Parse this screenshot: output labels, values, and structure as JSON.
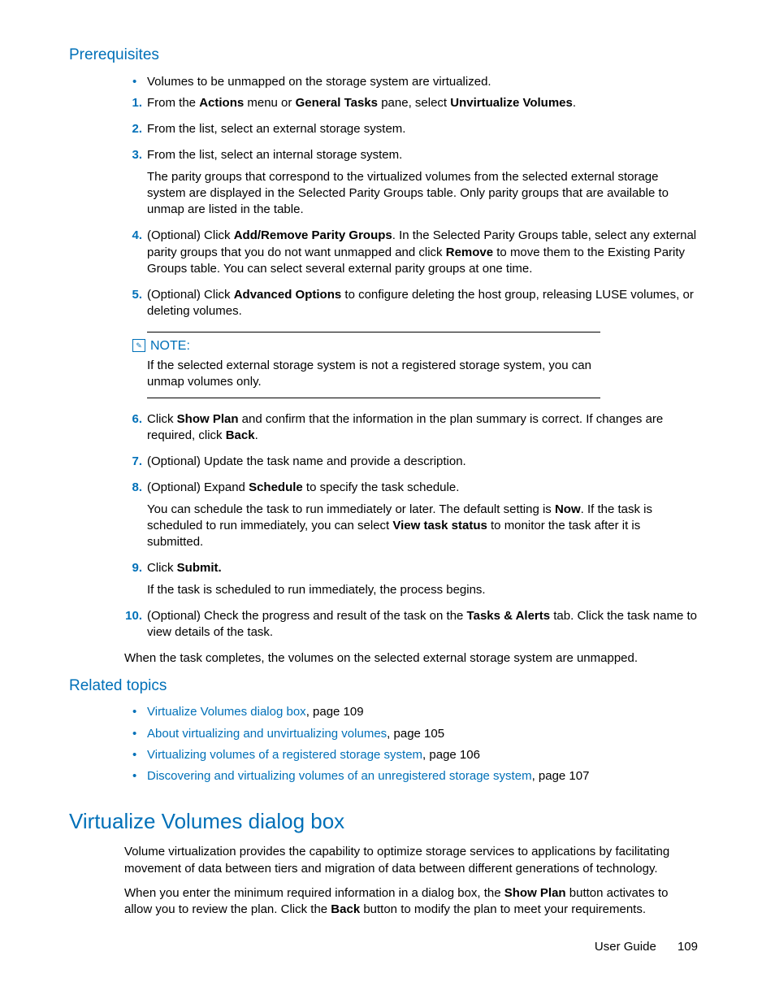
{
  "sections": {
    "prereq_heading": "Prerequisites",
    "related_heading": "Related topics",
    "dialog_heading": "Virtualize Volumes dialog box"
  },
  "prereq_bullet": "Volumes to be unmapped on the storage system are virtualized.",
  "steps": {
    "s1": {
      "num": "1.",
      "pre": "From the ",
      "b1": "Actions",
      "mid1": " menu or ",
      "b2": "General Tasks",
      "mid2": " pane, select ",
      "b3": "Unvirtualize Volumes",
      "post": "."
    },
    "s2": {
      "num": "2.",
      "text": "From the list, select an external storage system."
    },
    "s3": {
      "num": "3.",
      "text": "From the list, select an internal storage system.",
      "sub": "The parity groups that correspond to the virtualized volumes from the selected external storage system are displayed in the Selected Parity Groups table. Only parity groups that are available to unmap are listed in the table."
    },
    "s4": {
      "num": "4.",
      "pre": "(Optional) Click ",
      "b1": "Add/Remove Parity Groups",
      "mid1": ". In the Selected Parity Groups table, select any external parity groups that you do not want unmapped and click ",
      "b2": "Remove",
      "post": " to move them to the Existing Parity Groups table. You can select several external parity groups at one time."
    },
    "s5": {
      "num": "5.",
      "pre": "(Optional) Click ",
      "b1": "Advanced Options",
      "post": " to configure deleting the host group, releasing LUSE volumes, or deleting volumes."
    },
    "s6": {
      "num": "6.",
      "pre": "Click ",
      "b1": "Show Plan",
      "mid1": " and confirm that the information in the plan summary is correct. If changes are required, click ",
      "b2": "Back",
      "post": "."
    },
    "s7": {
      "num": "7.",
      "text": "(Optional) Update the task name and provide a description."
    },
    "s8": {
      "num": "8.",
      "pre": "(Optional) Expand ",
      "b1": "Schedule",
      "post": " to specify the task schedule.",
      "sub_pre": "You can schedule the task to run immediately or later. The default setting is ",
      "sub_b1": "Now",
      "sub_mid": ". If the task is scheduled to run immediately, you can select ",
      "sub_b2": "View task status",
      "sub_post": " to monitor the task after it is submitted."
    },
    "s9": {
      "num": "9.",
      "pre": "Click ",
      "b1": "Submit.",
      "sub": "If the task is scheduled to run immediately, the process begins."
    },
    "s10": {
      "num": "10.",
      "pre": "(Optional) Check the progress and result of the task on the ",
      "b1": "Tasks & Alerts",
      "post": " tab. Click the task name to view details of the task."
    }
  },
  "note": {
    "label": "NOTE:",
    "body": "If the selected external storage system is not a registered storage system, you can unmap volumes only."
  },
  "after_steps": "When the task completes, the volumes on the selected external storage system are unmapped.",
  "related": {
    "r1": {
      "link": "Virtualize Volumes dialog box",
      "tail": ", page 109"
    },
    "r2": {
      "link": "About virtualizing and unvirtualizing volumes",
      "tail": ", page 105"
    },
    "r3": {
      "link": "Virtualizing volumes of a registered storage system",
      "tail": ", page 106"
    },
    "r4": {
      "link": "Discovering and virtualizing volumes of an unregistered storage system",
      "tail": ", page 107"
    }
  },
  "dialog": {
    "p1": "Volume virtualization provides the capability to optimize storage services to applications by facilitating movement of data between tiers and migration of data between different generations of technology.",
    "p2_pre": "When you enter the minimum required information in a dialog box, the ",
    "p2_b1": "Show Plan",
    "p2_mid": " button activates to allow you to review the plan. Click the ",
    "p2_b2": "Back",
    "p2_post": " button to modify the plan to meet your requirements."
  },
  "footer": {
    "doc": "User Guide",
    "page": "109"
  }
}
